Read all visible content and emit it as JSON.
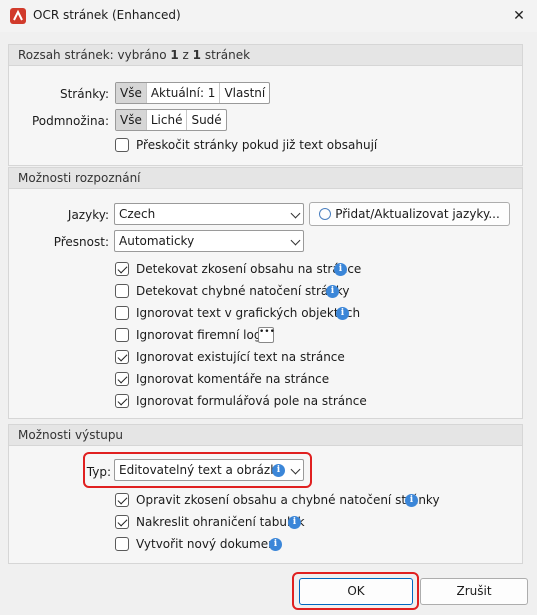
{
  "window": {
    "title": "OCR stránek (Enhanced)",
    "close_glyph": "✕"
  },
  "page_range": {
    "header": [
      "Rozsah stránek: vybráno ",
      "1",
      " z ",
      "1",
      " stránek"
    ],
    "pages_label": "Stránky:",
    "pages_options": [
      "Vše",
      "Aktuální: 1",
      "Vlastní"
    ],
    "pages_selected": "Vše",
    "subset_label": "Podmnožina:",
    "subset_options": [
      "Vše",
      "Liché",
      "Sudé"
    ],
    "subset_selected": "Vše",
    "skip_label": "Přeskočit stránky pokud již text obsahují",
    "skip_checked": false
  },
  "recognition": {
    "header": "Možnosti rozpoznání",
    "languages_label": "Jazyky:",
    "languages_value": "Czech",
    "add_languages_button": "Přidat/Aktualizovat jazyky...",
    "accuracy_label": "Přesnost:",
    "accuracy_value": "Automaticky",
    "options": [
      {
        "label": "Detekovat zkosení obsahu na stránce",
        "checked": true,
        "info": true
      },
      {
        "label": "Detekovat chybné natočení stránky",
        "checked": false,
        "info": true
      },
      {
        "label": "Ignorovat text v grafických objektech",
        "checked": false,
        "info": true
      },
      {
        "label": "Ignorovat firemní loga",
        "checked": false,
        "info": false,
        "more": "•••"
      },
      {
        "label": "Ignorovat existující text na stránce",
        "checked": true,
        "info": false
      },
      {
        "label": "Ignorovat komentáře na stránce",
        "checked": true,
        "info": false
      },
      {
        "label": "Ignorovat formulářová pole na stránce",
        "checked": true,
        "info": false
      }
    ]
  },
  "output": {
    "header": "Možnosti výstupu",
    "type_label": "Typ:",
    "type_value": "Editovatelný text a obrázky",
    "options": [
      {
        "label": "Opravit zkosení obsahu a chybné natočení stránky",
        "checked": true,
        "info": true
      },
      {
        "label": "Nakreslit ohraničení tabulek",
        "checked": true,
        "info": true
      },
      {
        "label": "Vytvořit nový dokument",
        "checked": false,
        "info": true
      }
    ]
  },
  "footer": {
    "ok_button": "OK",
    "cancel_button": "Zrušit"
  },
  "info_glyph": "i",
  "colors": {
    "highlight": "#e02020",
    "info": "#3b86d8",
    "app_icon": "#d13a2b"
  }
}
